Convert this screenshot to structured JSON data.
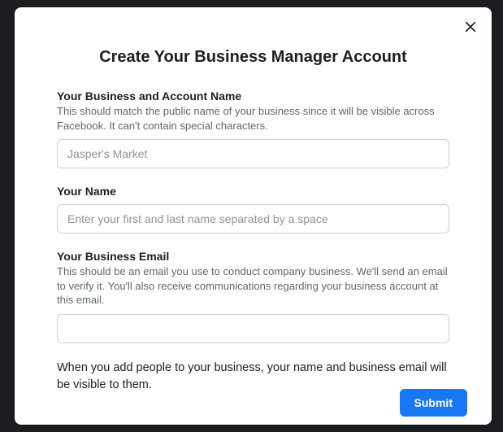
{
  "dialog": {
    "title": "Create Your Business Manager Account",
    "fields": {
      "business_name": {
        "label": "Your Business and Account Name",
        "help": "This should match the public name of your business since it will be visible across Facebook. It can't contain special characters.",
        "placeholder": "Jasper's Market"
      },
      "your_name": {
        "label": "Your Name",
        "placeholder": "Enter your first and last name separated by a space"
      },
      "business_email": {
        "label": "Your Business Email",
        "help": "This should be an email you use to conduct company business. We'll send an email to verify it. You'll also receive communications regarding your business account at this email."
      }
    },
    "notice": "When you add people to your business, your name and business email will be visible to them.",
    "submit_label": "Submit"
  }
}
